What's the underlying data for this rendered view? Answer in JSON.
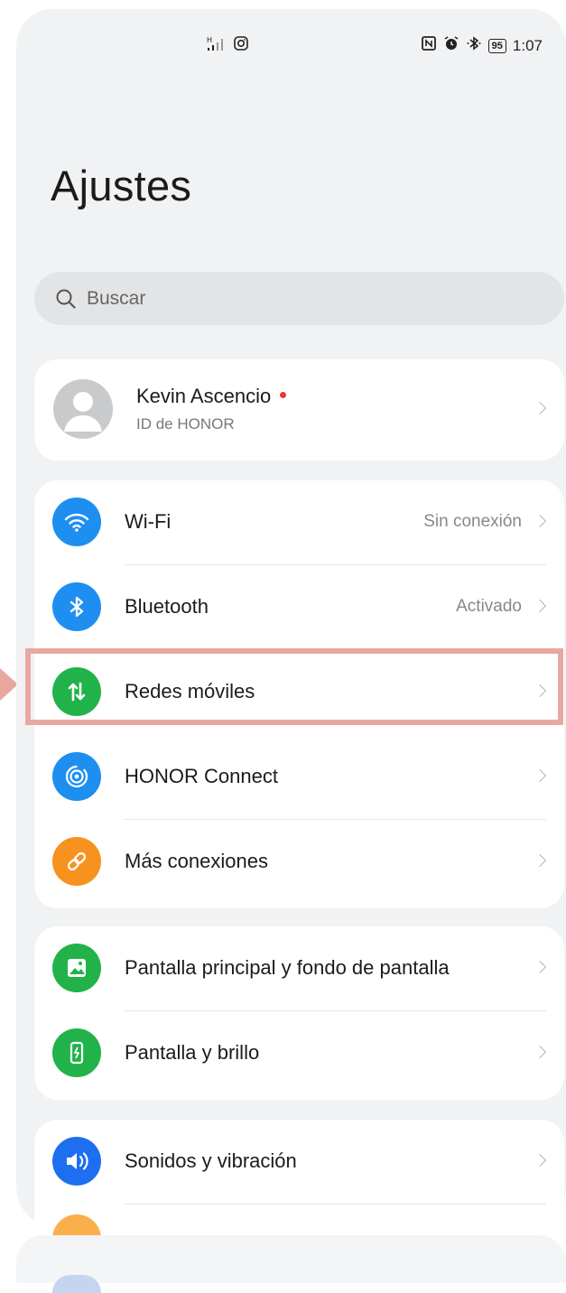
{
  "status_bar": {
    "time": "1:07",
    "battery": "95",
    "left_icons": [
      "signal-icon",
      "instagram-icon"
    ],
    "right_icons": [
      "nfc-icon",
      "alarm-icon",
      "bluetooth-icon"
    ]
  },
  "page": {
    "title": "Ajustes"
  },
  "search": {
    "placeholder": "Buscar"
  },
  "profile": {
    "name": "Kevin Ascencio",
    "subtitle": "ID de HONOR"
  },
  "groups": [
    {
      "items": [
        {
          "label": "Wi-Fi",
          "value": "Sin conexión",
          "icon": "wifi-icon",
          "color": "#1e8ff0"
        },
        {
          "label": "Bluetooth",
          "value": "Activado",
          "icon": "bluetooth-icon",
          "color": "#1e8ff0"
        },
        {
          "label": "Redes móviles",
          "value": "",
          "icon": "mobile-data-icon",
          "color": "#21b34a"
        },
        {
          "label": "HONOR Connect",
          "value": "",
          "icon": "honor-connect-icon",
          "color": "#1e8ff0"
        },
        {
          "label": "Más conexiones",
          "value": "",
          "icon": "link-icon",
          "color": "#f7921e"
        }
      ]
    },
    {
      "items": [
        {
          "label": "Pantalla principal y fondo de pantalla",
          "value": "",
          "icon": "wallpaper-icon",
          "color": "#21b34a"
        },
        {
          "label": "Pantalla y brillo",
          "value": "",
          "icon": "display-brightness-icon",
          "color": "#21b34a"
        }
      ]
    },
    {
      "items": [
        {
          "label": "Sonidos y vibración",
          "value": "",
          "icon": "sound-icon",
          "color": "#1e6ff0"
        }
      ]
    }
  ],
  "colors": {
    "highlight": "#e8a8a1",
    "badge": "#e53935",
    "background": "#f1f2f4"
  }
}
